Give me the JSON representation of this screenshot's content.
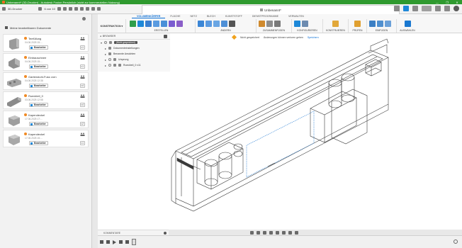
{
  "titlebar": {
    "title": "Unbenannt* (3D-Drucker) - Autodesk Fusion Persönlich (nicht zur kommerziellen Nutzung)",
    "controls": [
      "—",
      "❐",
      "✕"
    ]
  },
  "appbar": {
    "project": "3D-Drucker",
    "job_status": "6 von 10",
    "doc_tab": "Unbenannt*"
  },
  "ribbon": {
    "tabs": [
      "VOLUMENKÖRPER",
      "FLÄCHE",
      "NETZ",
      "BLECH",
      "KUNSTSTOFF",
      "DIENSTPROGRAMME",
      "VERWALTEN"
    ],
    "active_tab": "VOLUMENKÖRPER",
    "workspace": "KONSTRUKTION",
    "groups": [
      "ERSTELLEN",
      "ÄNDERN",
      "ZUSAMMENFÜGEN",
      "KONFIGURIEREN",
      "KONSTRUIEREN",
      "PRÜFEN",
      "EINFÜGEN",
      "AUSWÄHLEN"
    ]
  },
  "leftpanel": {
    "breadcrumb": "Meine bearbeitbaren Dokumente",
    "edit_label": "Bearbeiter",
    "items": [
      {
        "name": "Teefüllung",
        "date": "04.06.2025 15:...",
        "ver": "v1"
      },
      {
        "name": "Einbauschnee",
        "date": "04.06.2025 15:...",
        "ver": "v1"
      },
      {
        "name": "Gartenstuhl-Fuss vorn",
        "date": "04.06.2025 12:38",
        "ver": "v4"
      },
      {
        "name": "Rueckteil_0",
        "date": "03.06.2025 12:58",
        "ver": "v4"
      },
      {
        "name": "Kapendeckel",
        "date": "17.06.2025 17:...",
        "ver": "v2"
      },
      {
        "name": "Kapendeckel",
        "date": "17.06.2025 15:...",
        "ver": "v1"
      }
    ]
  },
  "browser": {
    "header": "BROWSER",
    "root": "(Nicht gespeichert)",
    "rows": [
      "Dokumenteinstellungen",
      "Benannte Ansichten",
      "Ursprung",
      "Rueckteil_0 v11"
    ]
  },
  "notice": {
    "status": "Nicht gespeichert",
    "message": "Änderungen können verloren gehen",
    "action": "Speichern"
  },
  "comments": {
    "label": "KOMMENTARE"
  },
  "colors": {
    "titlebar": "#2f9a2f",
    "accent": "#0a6fd6",
    "warning": "#f0a21e"
  }
}
